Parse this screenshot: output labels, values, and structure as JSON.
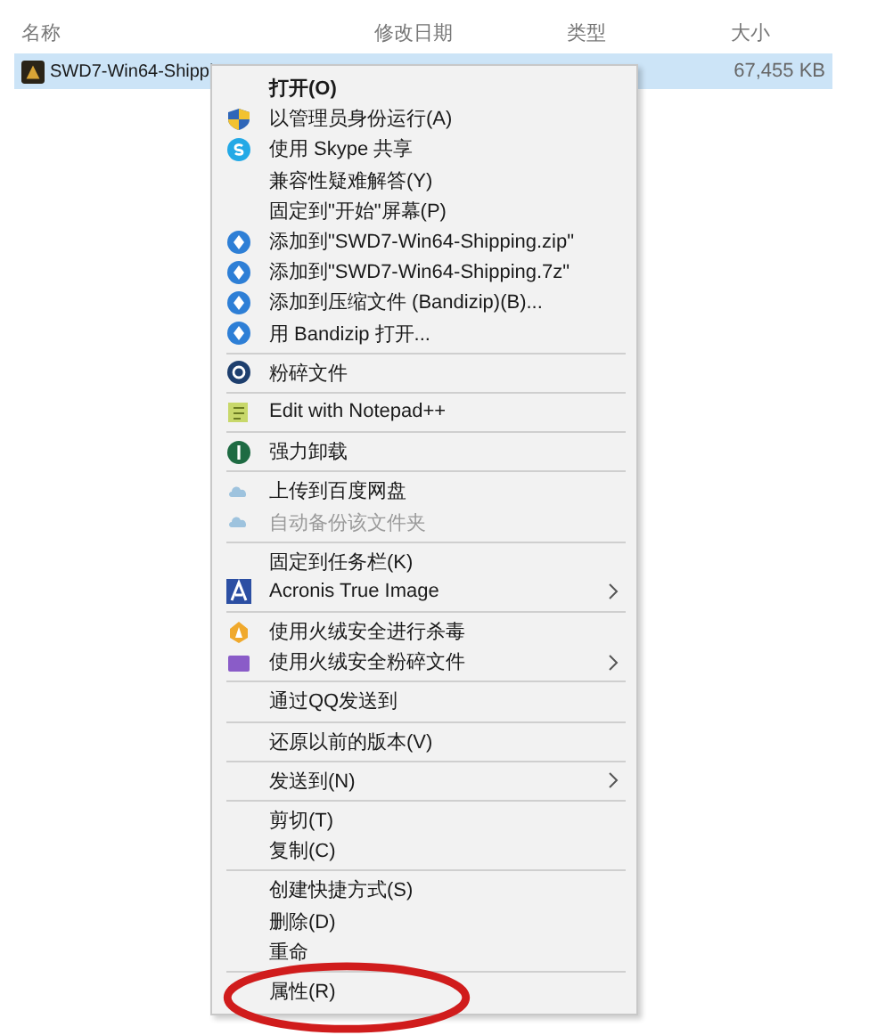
{
  "columns": [
    {
      "label": "名称"
    },
    {
      "label": "修改日期"
    },
    {
      "label": "类型"
    },
    {
      "label": "大小"
    }
  ],
  "file": {
    "name": "SWD7-Win64-Shippi",
    "size": "67,455 KB",
    "selected": true
  },
  "menu": {
    "groups": [
      [
        {
          "label": "打开(O)",
          "kind": "plain",
          "bold": true,
          "disabled": false,
          "submenu": false
        },
        {
          "label": "以管理员身份运行(A)",
          "kind": "shield",
          "bold": false,
          "disabled": false,
          "submenu": false
        },
        {
          "label": "使用 Skype 共享",
          "kind": "skype",
          "bold": false,
          "disabled": false,
          "submenu": false
        },
        {
          "label": "兼容性疑难解答(Y)",
          "kind": "plain",
          "bold": false,
          "disabled": false,
          "submenu": false
        },
        {
          "label": "固定到\"开始\"屏幕(P)",
          "kind": "plain",
          "bold": false,
          "disabled": false,
          "submenu": false
        },
        {
          "label": "添加到\"SWD7-Win64-Shipping.zip\"",
          "kind": "bandizip",
          "bold": false,
          "disabled": false,
          "submenu": false
        },
        {
          "label": "添加到\"SWD7-Win64-Shipping.7z\"",
          "kind": "bandizip",
          "bold": false,
          "disabled": false,
          "submenu": false
        },
        {
          "label": "添加到压缩文件 (Bandizip)(B)...",
          "kind": "bandizip",
          "bold": false,
          "disabled": false,
          "submenu": false
        },
        {
          "label": "用 Bandizip 打开...",
          "kind": "bandizip",
          "bold": false,
          "disabled": false,
          "submenu": false
        }
      ],
      [
        {
          "label": "粉碎文件",
          "kind": "shred",
          "bold": false,
          "disabled": false,
          "submenu": false
        }
      ],
      [
        {
          "label": "Edit with Notepad++",
          "kind": "notepad",
          "bold": false,
          "disabled": false,
          "submenu": false
        }
      ],
      [
        {
          "label": "强力卸载",
          "kind": "uninstall",
          "bold": false,
          "disabled": false,
          "submenu": false
        }
      ],
      [
        {
          "label": "上传到百度网盘",
          "kind": "cloud",
          "bold": false,
          "disabled": false,
          "submenu": false
        },
        {
          "label": "自动备份该文件夹",
          "kind": "cloud",
          "bold": false,
          "disabled": true,
          "submenu": false
        }
      ],
      [
        {
          "label": "固定到任务栏(K)",
          "kind": "plain",
          "bold": false,
          "disabled": false,
          "submenu": false
        },
        {
          "label": "Acronis True Image",
          "kind": "acronis",
          "bold": false,
          "disabled": false,
          "submenu": true
        }
      ],
      [
        {
          "label": "使用火绒安全进行杀毒",
          "kind": "flame",
          "bold": false,
          "disabled": false,
          "submenu": false
        },
        {
          "label": "使用火绒安全粉碎文件",
          "kind": "shredder",
          "bold": false,
          "disabled": false,
          "submenu": true
        }
      ],
      [
        {
          "label": "通过QQ发送到",
          "kind": "plain",
          "bold": false,
          "disabled": false,
          "submenu": false
        }
      ],
      [
        {
          "label": "还原以前的版本(V)",
          "kind": "plain",
          "bold": false,
          "disabled": false,
          "submenu": false
        }
      ],
      [
        {
          "label": "发送到(N)",
          "kind": "plain",
          "bold": false,
          "disabled": false,
          "submenu": true
        }
      ],
      [
        {
          "label": "剪切(T)",
          "kind": "plain",
          "bold": false,
          "disabled": false,
          "submenu": false
        },
        {
          "label": "复制(C)",
          "kind": "plain",
          "bold": false,
          "disabled": false,
          "submenu": false
        }
      ],
      [
        {
          "label": "创建快捷方式(S)",
          "kind": "plain",
          "bold": false,
          "disabled": false,
          "submenu": false
        },
        {
          "label": "删除(D)",
          "kind": "plain",
          "bold": false,
          "disabled": false,
          "submenu": false
        },
        {
          "label": "重命",
          "kind": "plain",
          "bold": false,
          "disabled": false,
          "submenu": false
        }
      ],
      [
        {
          "label": "属性(R)",
          "kind": "plain",
          "bold": false,
          "disabled": false,
          "submenu": false
        }
      ]
    ]
  }
}
